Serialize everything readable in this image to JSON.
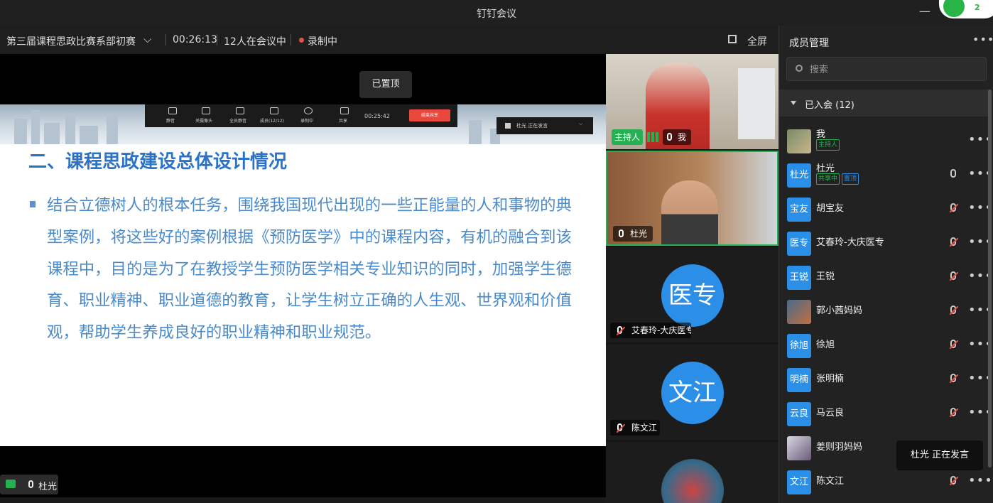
{
  "window": {
    "title": "钉钉会议",
    "wifi_badge": "2"
  },
  "infobar": {
    "meeting_name": "第三届课程思政比赛系部初赛",
    "duration": "00:26:13",
    "attendees": "12人在会议中",
    "recording": "录制中",
    "fullscreen": "全屏"
  },
  "stage": {
    "pinned_label": "已置顶",
    "bottom_speaker": "杜光",
    "share_toolbar": {
      "items": [
        "静音",
        "关摄像头",
        "全员静音",
        "成员(12/12)",
        "录制中",
        "共享"
      ],
      "timer": "00:25:42",
      "end_share": "结束共享",
      "speaking": "杜光  正在发言"
    },
    "slide": {
      "heading": "二、课程思政建设总体设计情况",
      "paragraph": "结合立德树人的根本任务，围绕我国现代出现的一些正能量的人和事物的典型案例，将这些好的案例根据《预防医学》中的课程内容，有机的融合到该课程中，目的是为了在教授学生预防医学相关专业知识的同时，加强学生德育、职业精神、职业道德的教育，让学生树立正确的人生观、世界观和价值观，帮助学生养成良好的职业精神和职业规范。"
    }
  },
  "videos": [
    {
      "host_tag": "主持人",
      "name": "我"
    },
    {
      "name": "杜光"
    },
    {
      "avatar": "医专",
      "name": "艾春玲-大庆医专"
    },
    {
      "avatar": "文江",
      "name": "陈文江"
    }
  ],
  "panel": {
    "title": "成员管理",
    "search_placeholder": "搜索",
    "group": "已入会 (12)",
    "members": [
      {
        "avatar": "",
        "name": "我",
        "tags": [
          "主持人"
        ],
        "mic": "on"
      },
      {
        "avatar": "杜光",
        "name": "杜光",
        "tags": [
          "共享中",
          "置顶"
        ],
        "mic": "on"
      },
      {
        "avatar": "宝友",
        "name": "胡宝友",
        "tags": [],
        "mic": "off"
      },
      {
        "avatar": "医专",
        "name": "艾春玲-大庆医专",
        "tags": [],
        "mic": "off"
      },
      {
        "avatar": "王锐",
        "name": "王锐",
        "tags": [],
        "mic": "off"
      },
      {
        "avatar": "",
        "name": "郭小茜妈妈",
        "tags": [],
        "mic": "off"
      },
      {
        "avatar": "徐旭",
        "name": "徐旭",
        "tags": [],
        "mic": "off"
      },
      {
        "avatar": "明楠",
        "name": "张明楠",
        "tags": [],
        "mic": "off"
      },
      {
        "avatar": "云良",
        "name": "马云良",
        "tags": [],
        "mic": "off"
      },
      {
        "avatar": "",
        "name": "姜则羽妈妈",
        "tags": [],
        "mic": "off"
      },
      {
        "avatar": "文江",
        "name": "陈文江",
        "tags": [],
        "mic": "off"
      }
    ]
  },
  "toast": "杜光  正在发言",
  "colors": {
    "accent": "#2b8fe8",
    "host_green": "#27b052",
    "record_red": "#e0534a",
    "slide_text": "#4a8ac8"
  }
}
